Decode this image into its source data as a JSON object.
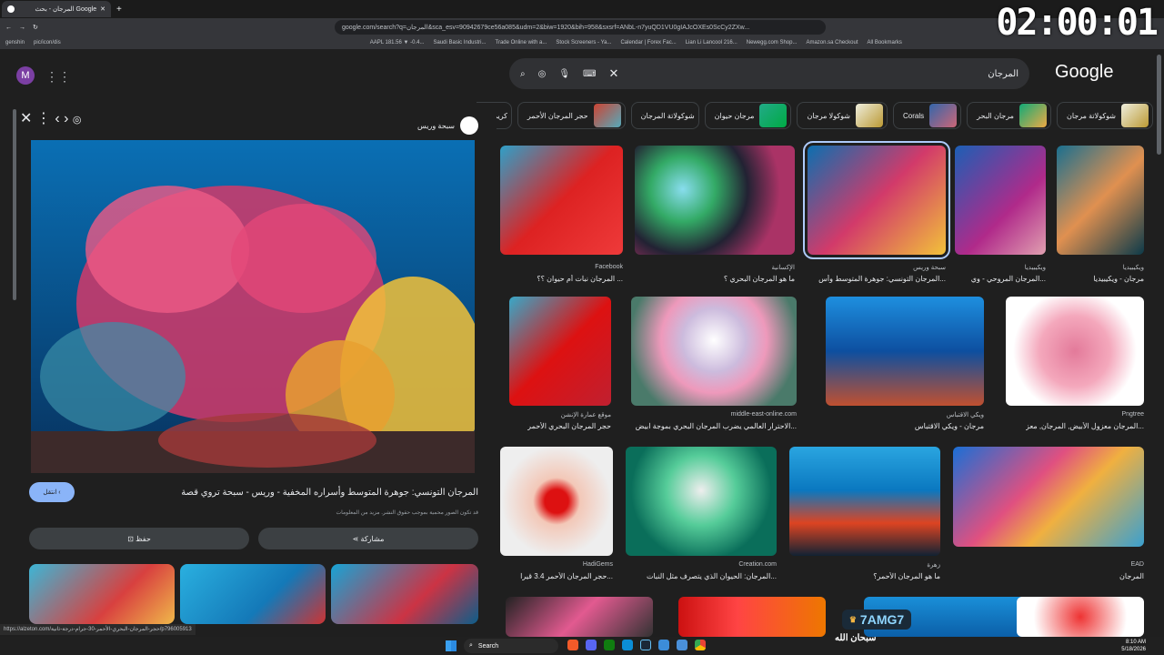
{
  "browser": {
    "tab_title": "المرجان - بحث Google",
    "url": "google.com/search?q=المرجان&sca_esv=90942679ce56a085&udm=2&biw=1920&bih=958&sxsrf=ANbL-n7yuQD1VU0gIAJcOXEs0ScCy2ZXw...",
    "bookmarks": [
      "genshin",
      "pic/icon/dis",
      "AAPL 181.56 ▼ -0.4...",
      "Saudi Basic Industri...",
      "Trade Online with a...",
      "Stock Screeners - Ya...",
      "Calendar | Forex Fac...",
      "Lian Li Lancool 216...",
      "Newegg.com Shop...",
      "Amazon.sa Checkout",
      "All Bookmarks"
    ]
  },
  "overlay": {
    "timer": "02:00:01",
    "badge": "7AMG7",
    "subtitle": "سبحان الله"
  },
  "header": {
    "avatar": "M",
    "query": "المرجان",
    "logo": "Google"
  },
  "chips": [
    "شوكولاتة مرجان",
    "مرجان البحر",
    "Corals",
    "شوكولا مرجان",
    "مرجان حيوان",
    "شوكولاتة المرجان",
    "حجر المرجان الأحمر",
    "كريمة الينابيع"
  ],
  "preview": {
    "source": "سبحة وريس",
    "title": "المرجان التونسي: جوهرة المتوسط وأسراره المخفية - وريس - سبحة تروي قصة",
    "note": "قد تكون الصور محمية بموجب حقوق النشر. مزيد من المعلومات",
    "visit": "انتقل",
    "share": "مشاركة",
    "save": "حفظ"
  },
  "results": [
    {
      "site": "Facebook",
      "cap": "المرجان نبات أم حيوان ؟؟ ..."
    },
    {
      "site": "الإكسانية",
      "cap": "ما هو المرجان البحري ؟"
    },
    {
      "site": "سبحة وريس",
      "cap": "المرجان التونسي: جوهرة المتوسط وأس..."
    },
    {
      "site": "ويكيبيديا",
      "cap": "المرجان المروحي - وي..."
    },
    {
      "site": "ويكيبيديا",
      "cap": "مرجان - ويكيبيديا"
    },
    {
      "site": "موقع عمارة الإنشن",
      "cap": "حجر المرجان البحري الأحمر"
    },
    {
      "site": "middle-east-online.com",
      "cap": "الاحترار العالمي يضرب المرجان البحري بموجة ابيض..."
    },
    {
      "site": "ويكي الاقتباس",
      "cap": "مرجان - ويكي الاقتباس"
    },
    {
      "site": "Pngtree",
      "cap": "المرجان معزول الأبيض, المرجان, معز..."
    },
    {
      "site": "HadiGems",
      "cap": "حجر المرجان الأحمر 3.4 قيرا..."
    },
    {
      "site": "Creation.com",
      "cap": "المرجان: الحيوان الذي يتصرف مثل النبات..."
    },
    {
      "site": "زهرة",
      "cap": "ما هو المرجان الأحمر؟"
    },
    {
      "site": "EAD",
      "cap": "المرجان"
    }
  ],
  "status_url": "https://alzeton.com/حجر-المرجان-البحري-الأحمر-30-جرام-درجة-ثانية/p796005913",
  "taskbar": {
    "search": "Search",
    "time": "8:10 AM",
    "date": "5/18/2026"
  }
}
